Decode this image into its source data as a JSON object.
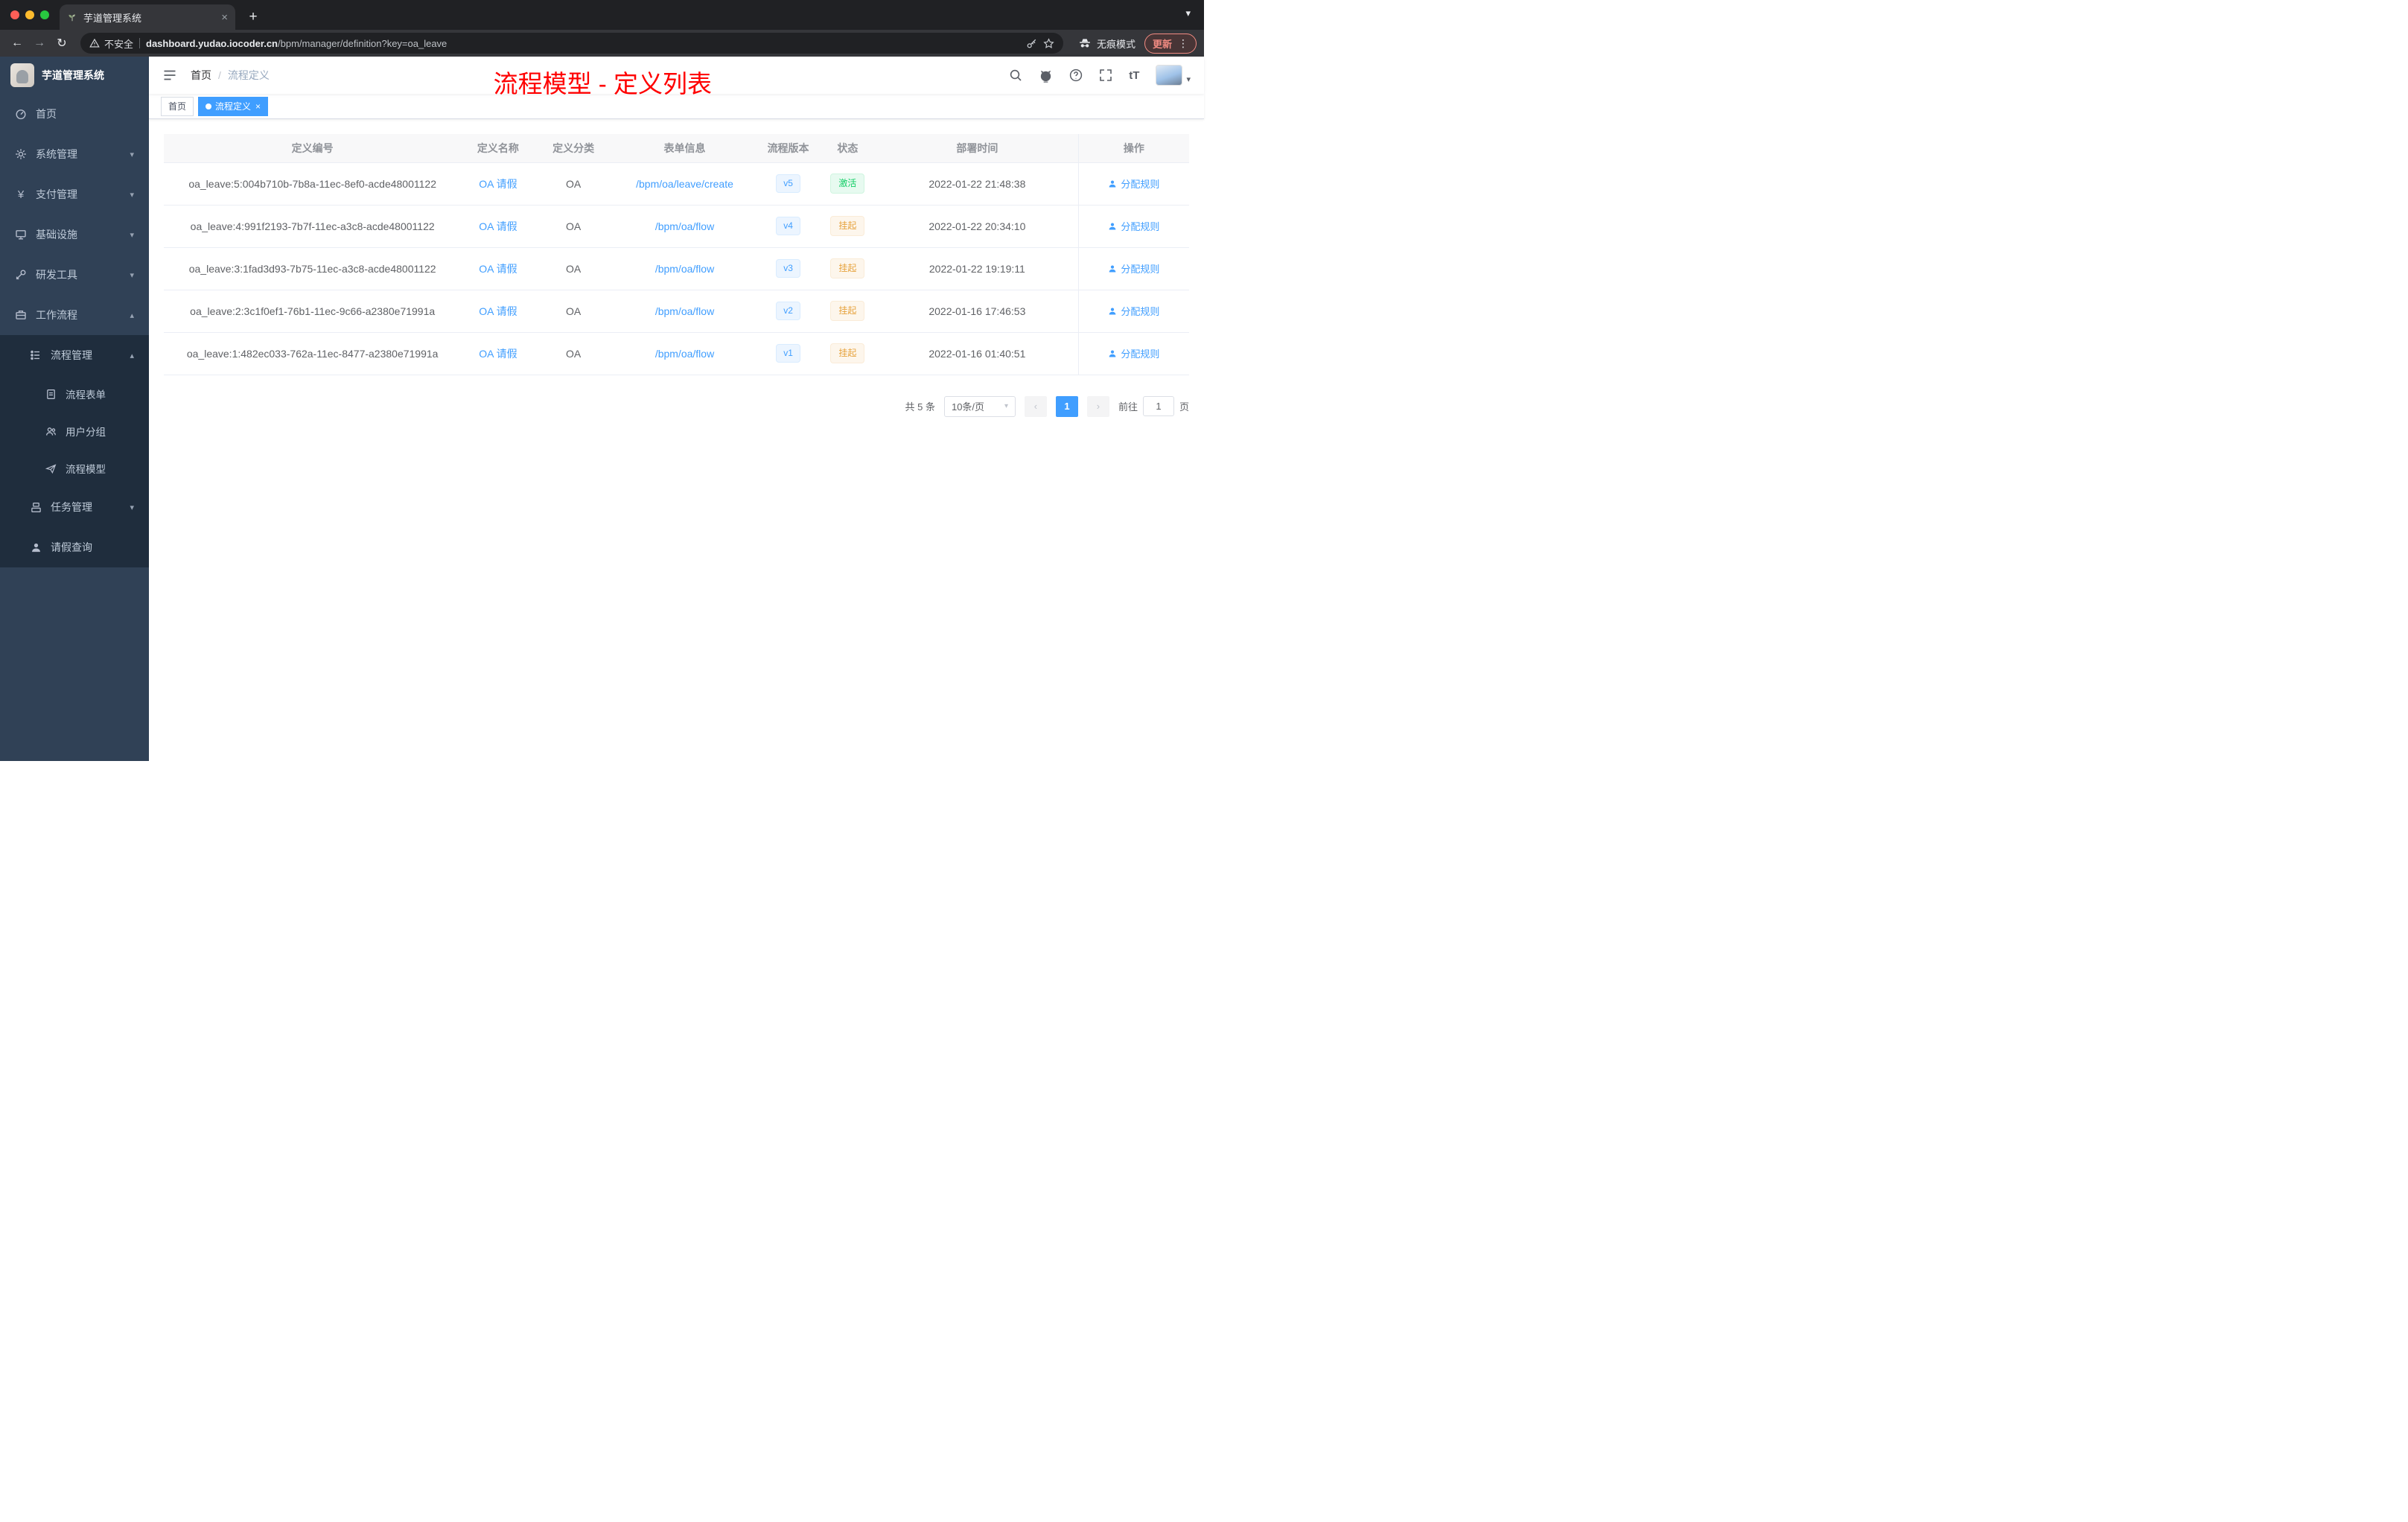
{
  "browser": {
    "tab_title": "芋道管理系统",
    "security_label": "不安全",
    "url_domain": "dashboard.yudao.iocoder.cn",
    "url_path": "/bpm/manager/definition?key=oa_leave",
    "incognito_label": "无痕模式",
    "update_label": "更新"
  },
  "glyphs": {
    "close": "×",
    "plus": "+",
    "back": "←",
    "forward": "→",
    "reload": "↻",
    "dots": "⋮",
    "chevron_down": "▾",
    "chevron_up": "▴",
    "caret_down": "▾",
    "prev": "‹",
    "next": "›",
    "slash": "/",
    "yen": "¥",
    "font_size": "tT"
  },
  "sidebar": {
    "app_title": "芋道管理系统",
    "items": [
      {
        "label": "首页"
      },
      {
        "label": "系统管理"
      },
      {
        "label": "支付管理"
      },
      {
        "label": "基础设施"
      },
      {
        "label": "研发工具"
      },
      {
        "label": "工作流程"
      },
      {
        "label": "流程管理"
      },
      {
        "label": "流程表单"
      },
      {
        "label": "用户分组"
      },
      {
        "label": "流程模型"
      },
      {
        "label": "任务管理"
      },
      {
        "label": "请假查询"
      }
    ]
  },
  "header": {
    "breadcrumb_home": "首页",
    "breadcrumb_current": "流程定义"
  },
  "annotation": {
    "text": "流程模型 - 定义列表"
  },
  "tags": {
    "home": "首页",
    "active": "流程定义"
  },
  "table": {
    "columns": [
      "定义编号",
      "定义名称",
      "定义分类",
      "表单信息",
      "流程版本",
      "状态",
      "部署时间",
      "操作"
    ],
    "rows": [
      {
        "id": "oa_leave:5:004b710b-7b8a-11ec-8ef0-acde48001122",
        "name": "OA 请假",
        "category": "OA",
        "form": "/bpm/oa/leave/create",
        "version": "v5",
        "status": "激活",
        "deployed_at": "2022-01-22 21:48:38",
        "action": "分配规则"
      },
      {
        "id": "oa_leave:4:991f2193-7b7f-11ec-a3c8-acde48001122",
        "name": "OA 请假",
        "category": "OA",
        "form": "/bpm/oa/flow",
        "version": "v4",
        "status": "挂起",
        "deployed_at": "2022-01-22 20:34:10",
        "action": "分配规则"
      },
      {
        "id": "oa_leave:3:1fad3d93-7b75-11ec-a3c8-acde48001122",
        "name": "OA 请假",
        "category": "OA",
        "form": "/bpm/oa/flow",
        "version": "v3",
        "status": "挂起",
        "deployed_at": "2022-01-22 19:19:11",
        "action": "分配规则"
      },
      {
        "id": "oa_leave:2:3c1f0ef1-76b1-11ec-9c66-a2380e71991a",
        "name": "OA 请假",
        "category": "OA",
        "form": "/bpm/oa/flow",
        "version": "v2",
        "status": "挂起",
        "deployed_at": "2022-01-16 17:46:53",
        "action": "分配规则"
      },
      {
        "id": "oa_leave:1:482ec033-762a-11ec-8477-a2380e71991a",
        "name": "OA 请假",
        "category": "OA",
        "form": "/bpm/oa/flow",
        "version": "v1",
        "status": "挂起",
        "deployed_at": "2022-01-16 01:40:51",
        "action": "分配规则"
      }
    ]
  },
  "pagination": {
    "total": "共 5 条",
    "page_size": "10条/页",
    "page": "1",
    "goto_label": "前往",
    "goto_value": "1",
    "unit": "页"
  },
  "colors": {
    "accent": "#409eff",
    "success": "#13ce66",
    "warning": "#e6a23c",
    "sidebar_bg": "#304156",
    "submenu_bg": "#1f2d3d",
    "annotation_red": "#ff0000",
    "chrome_bg": "#202124",
    "toolbar_bg": "#35363a"
  }
}
